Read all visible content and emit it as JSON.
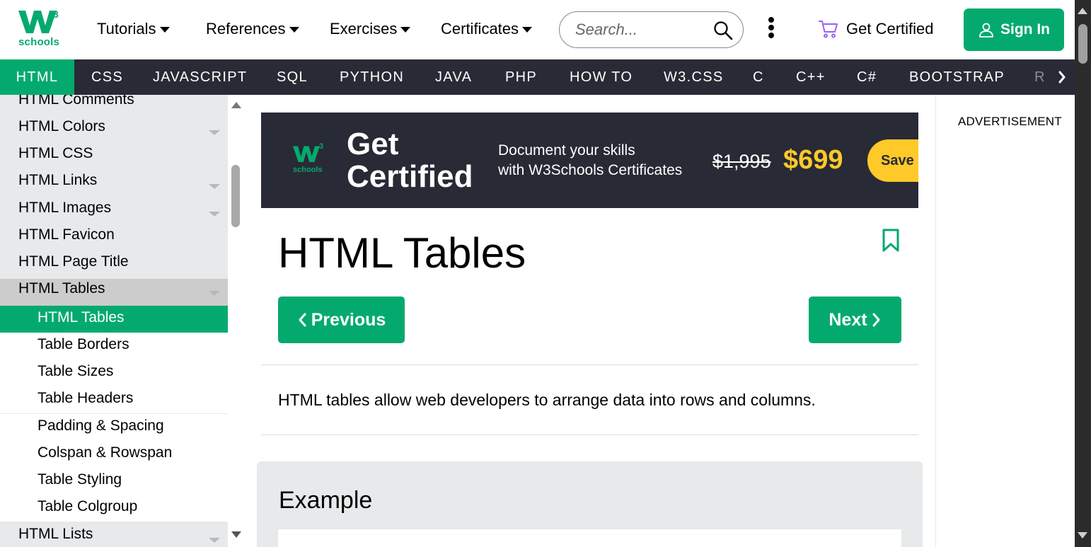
{
  "brand": {
    "logo_sup": "3",
    "logo_text": "schools",
    "accent_color": "#04AA6D",
    "dark_nav_color": "#282A35",
    "sidebar_color": "#E7E9EB"
  },
  "header": {
    "nav": [
      {
        "label": "Tutorials"
      },
      {
        "label": "References"
      },
      {
        "label": "Exercises"
      },
      {
        "label": "Certificates"
      }
    ],
    "search": {
      "placeholder": "Search...",
      "value": "",
      "icon": "search-icon"
    },
    "more_icon": "vertical-dots-icon",
    "get_certified": {
      "label": "Get Certified",
      "icon": "cart-icon"
    },
    "sign_in": {
      "label": "Sign In",
      "icon": "user-icon"
    }
  },
  "subjects": {
    "items": [
      {
        "label": "HTML",
        "active": true
      },
      {
        "label": "CSS"
      },
      {
        "label": "JAVASCRIPT"
      },
      {
        "label": "SQL"
      },
      {
        "label": "PYTHON"
      },
      {
        "label": "JAVA"
      },
      {
        "label": "PHP"
      },
      {
        "label": "HOW TO"
      },
      {
        "label": "W3.CSS"
      },
      {
        "label": "C"
      },
      {
        "label": "C++"
      },
      {
        "label": "C#"
      },
      {
        "label": "BOOTSTRAP"
      }
    ],
    "partial": "R",
    "scroll_icon": "chevron-right-icon"
  },
  "sidebar": {
    "items": [
      {
        "label": "HTML Comments",
        "dropdown": false
      },
      {
        "label": "HTML Colors",
        "dropdown": true
      },
      {
        "label": "HTML CSS",
        "dropdown": false
      },
      {
        "label": "HTML Links",
        "dropdown": true
      },
      {
        "label": "HTML Images",
        "dropdown": true
      },
      {
        "label": "HTML Favicon",
        "dropdown": false
      },
      {
        "label": "HTML Page Title",
        "dropdown": false
      },
      {
        "label": "HTML Tables",
        "dropdown": true,
        "expanded": true
      },
      {
        "label": "HTML Tables",
        "sub": true,
        "current": true
      },
      {
        "label": "Table Borders",
        "sub": true
      },
      {
        "label": "Table Sizes",
        "sub": true
      },
      {
        "label": "Table Headers",
        "sub": true
      },
      {
        "label": "Padding & Spacing",
        "sub": true
      },
      {
        "label": "Colspan & Rowspan",
        "sub": true
      },
      {
        "label": "Table Styling",
        "sub": true
      },
      {
        "label": "Table Colgroup",
        "sub": true
      },
      {
        "label": "HTML Lists",
        "dropdown": true
      }
    ]
  },
  "banner": {
    "title_line1": "Get",
    "title_line2": "Certified",
    "text_line1": "Document your skills",
    "text_line2": "with W3Schools Certificates",
    "old_price": "$1,995",
    "new_price": "$699",
    "cta": "Save",
    "price_color": "#FFC0C7",
    "cta_color": "#FFC929"
  },
  "main": {
    "title": "HTML Tables",
    "bookmark_icon": "bookmark-icon",
    "previous_label": "Previous",
    "next_label": "Next",
    "intro": "HTML tables allow web developers to arrange data into rows and columns.",
    "example_heading": "Example"
  },
  "right_column": {
    "advertisement": "ADVERTISEMENT"
  }
}
